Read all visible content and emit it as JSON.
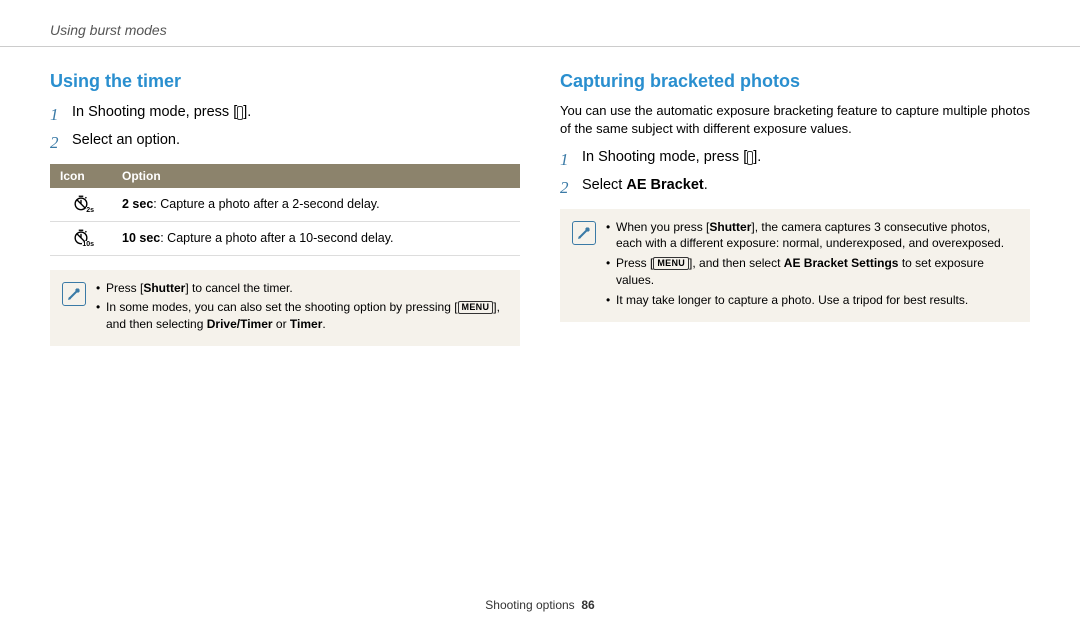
{
  "page_header": "Using burst modes",
  "footer": {
    "section": "Shooting options",
    "page": "86"
  },
  "left": {
    "title": "Using the timer",
    "steps": [
      {
        "prefix": "In Shooting mode, press [",
        "btn_glyph": "⏱",
        "suffix": "]."
      },
      {
        "text": "Select an option."
      }
    ],
    "table": {
      "headers": [
        "Icon",
        "Option"
      ],
      "rows": [
        {
          "icon_sub": "2s",
          "bold": "2 sec",
          "rest": ": Capture a photo after a 2-second delay."
        },
        {
          "icon_sub": "10s",
          "bold": "10 sec",
          "rest": ": Capture a photo after a 10-second delay."
        }
      ]
    },
    "notes": [
      {
        "pre": "Press [",
        "bold1": "Shutter",
        "mid": "] to cancel the timer.",
        "type": "simple"
      },
      {
        "pre": "In some modes, you can also set the shooting option by pressing [",
        "menu": "MENU",
        "mid": "], and then selecting ",
        "bold1": "Drive/Timer",
        "or": " or ",
        "bold2": "Timer",
        "end": ".",
        "type": "menu"
      }
    ]
  },
  "right": {
    "title": "Capturing bracketed photos",
    "intro": "You can use the automatic exposure bracketing feature to capture multiple photos of the same subject with different exposure values.",
    "steps": [
      {
        "prefix": "In Shooting mode, press [",
        "btn_glyph": "⏱",
        "suffix": "]."
      },
      {
        "prefix": "Select ",
        "bold": "AE Bracket",
        "suffix": "."
      }
    ],
    "notes": [
      {
        "pre": "When you press [",
        "bold1": "Shutter",
        "mid": "], the camera captures 3 consecutive photos, each with a different exposure: normal, underexposed, and overexposed.",
        "type": "simple"
      },
      {
        "pre": "Press [",
        "menu": "MENU",
        "mid": "], and then select ",
        "bold1": "AE Bracket Settings",
        "end": " to set exposure values.",
        "type": "menu"
      },
      {
        "pre": "It may take longer to capture a photo. Use a tripod for best results.",
        "type": "plain"
      }
    ]
  }
}
